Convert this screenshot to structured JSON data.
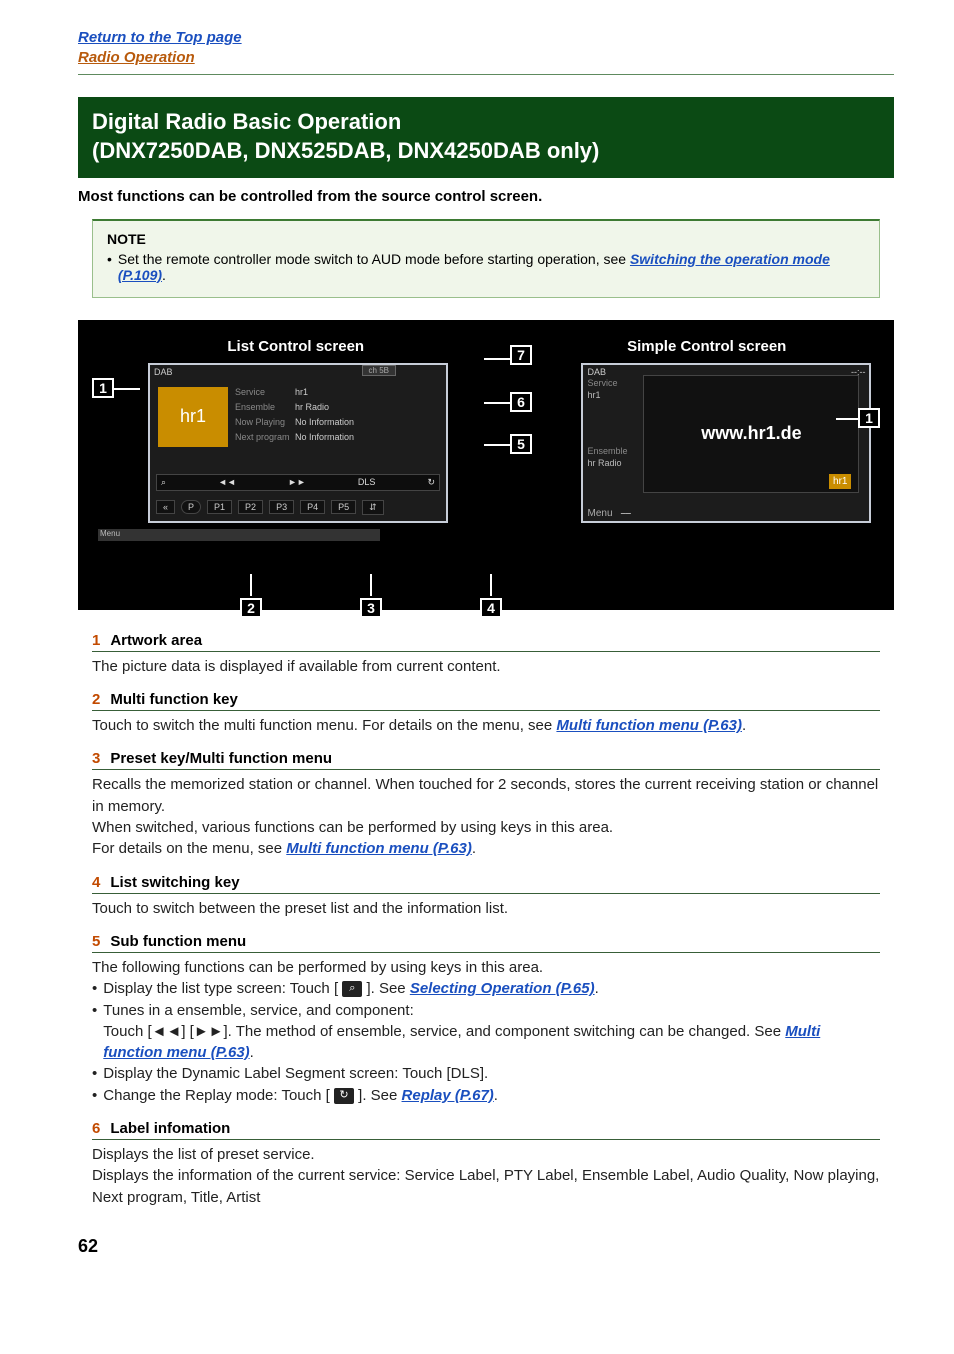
{
  "topNav": {
    "returnLink": "Return to the Top page",
    "sectionLink": "Radio Operation"
  },
  "heading": {
    "line1": "Digital Radio Basic Operation",
    "line2": "(DNX7250DAB, DNX525DAB, DNX4250DAB only)"
  },
  "intro": "Most functions can be controlled from the source control screen.",
  "note": {
    "title": "NOTE",
    "textBefore": "Set the remote controller mode switch to AUD mode before starting operation, see ",
    "link": "Switching the operation mode (P.109)",
    "textAfter": "."
  },
  "screens": {
    "leftTitle": "List Control screen",
    "rightTitle": "Simple Control screen",
    "left": {
      "source": "DAB",
      "clock": "",
      "tab": "ch 5B",
      "artworkText": "hr1",
      "info": [
        {
          "label": "Service",
          "value": "hr1"
        },
        {
          "label": "Ensemble",
          "value": "hr Radio"
        },
        {
          "label": "Now Playing",
          "value": "No Information"
        },
        {
          "label": "Next program",
          "value": "No Information"
        }
      ],
      "controls": {
        "search": "⌕",
        "prev": "◄◄",
        "next": "►►",
        "dls": "DLS",
        "replay": "↻"
      },
      "presets": {
        "leftArrow": "«",
        "mode": "P",
        "p1": "P1",
        "p2": "P2",
        "p3": "P3",
        "p4": "P4",
        "p5": "P5",
        "toggle": "⇵"
      },
      "menuBar": "Menu"
    },
    "right": {
      "source": "DAB",
      "clock": "--:--",
      "side": {
        "service": "Service",
        "serviceVal": "hr1",
        "ensemble": "Ensemble",
        "ensembleVal": "hr Radio"
      },
      "url": "www.hr1.de",
      "logo": "hr1",
      "menu": "Menu"
    },
    "callouts": {
      "c1": "1",
      "c2": "2",
      "c3": "3",
      "c4": "4",
      "c5": "5",
      "c6": "6",
      "c7": "7"
    }
  },
  "sections": [
    {
      "num": "1",
      "title": "Artwork area",
      "body": [
        {
          "t": "text",
          "v": "The picture data is displayed if available from current content."
        }
      ]
    },
    {
      "num": "2",
      "title": "Multi function key",
      "body": [
        {
          "t": "text",
          "v": "Touch to switch the multi function menu. For details on the menu, see "
        },
        {
          "t": "link",
          "v": "Multi function menu (P.63)"
        },
        {
          "t": "text",
          "v": "."
        }
      ]
    },
    {
      "num": "3",
      "title": "Preset key/Multi function menu",
      "body": [
        {
          "t": "para",
          "v": "Recalls the memorized station or channel. When touched for 2 seconds, stores the current receiving station or channel in memory."
        },
        {
          "t": "para",
          "v": "When switched, various functions can be performed by using keys in this area."
        },
        {
          "t": "inline",
          "parts": [
            {
              "t": "text",
              "v": "For details on the menu, see "
            },
            {
              "t": "link",
              "v": "Multi function menu (P.63)"
            },
            {
              "t": "text",
              "v": "."
            }
          ]
        }
      ]
    },
    {
      "num": "4",
      "title": "List switching key",
      "body": [
        {
          "t": "text",
          "v": "Touch to switch between the preset list and the information list."
        }
      ]
    },
    {
      "num": "5",
      "title": "Sub function menu",
      "intro": "The following functions can be performed by using keys in this area.",
      "bullets": [
        {
          "bold": "Display the list type screen",
          "after": ": Touch [ ",
          "icon": "⌕",
          "after2": " ]. See ",
          "link": "Selecting Operation (P.65)",
          "end": "."
        },
        {
          "bold": "Tunes in a ensemble, service, and component",
          "after": ":",
          "line2before": "Touch [◄◄] [►►].  The method of ensemble, service, and component switching can be changed. See ",
          "line2link": "Multi function menu (P.63)",
          "line2end": "."
        },
        {
          "bold": "Display the Dynamic Label Segment screen",
          "after": ": Touch [DLS]."
        },
        {
          "bold": "Change the Replay mode",
          "after": ": Touch [ ",
          "icon": "↻",
          "after2": " ]. See ",
          "link": "Replay (P.67)",
          "end": "."
        }
      ]
    },
    {
      "num": "6",
      "title": "Label infomation",
      "body": [
        {
          "t": "para",
          "v": "Displays the list of preset service."
        },
        {
          "t": "para",
          "v": "Displays the information of the current service: Service Label, PTY Label, Ensemble Label, Audio Quality, Now playing, Next program, Title, Artist"
        }
      ]
    }
  ],
  "pageNumber": "62"
}
